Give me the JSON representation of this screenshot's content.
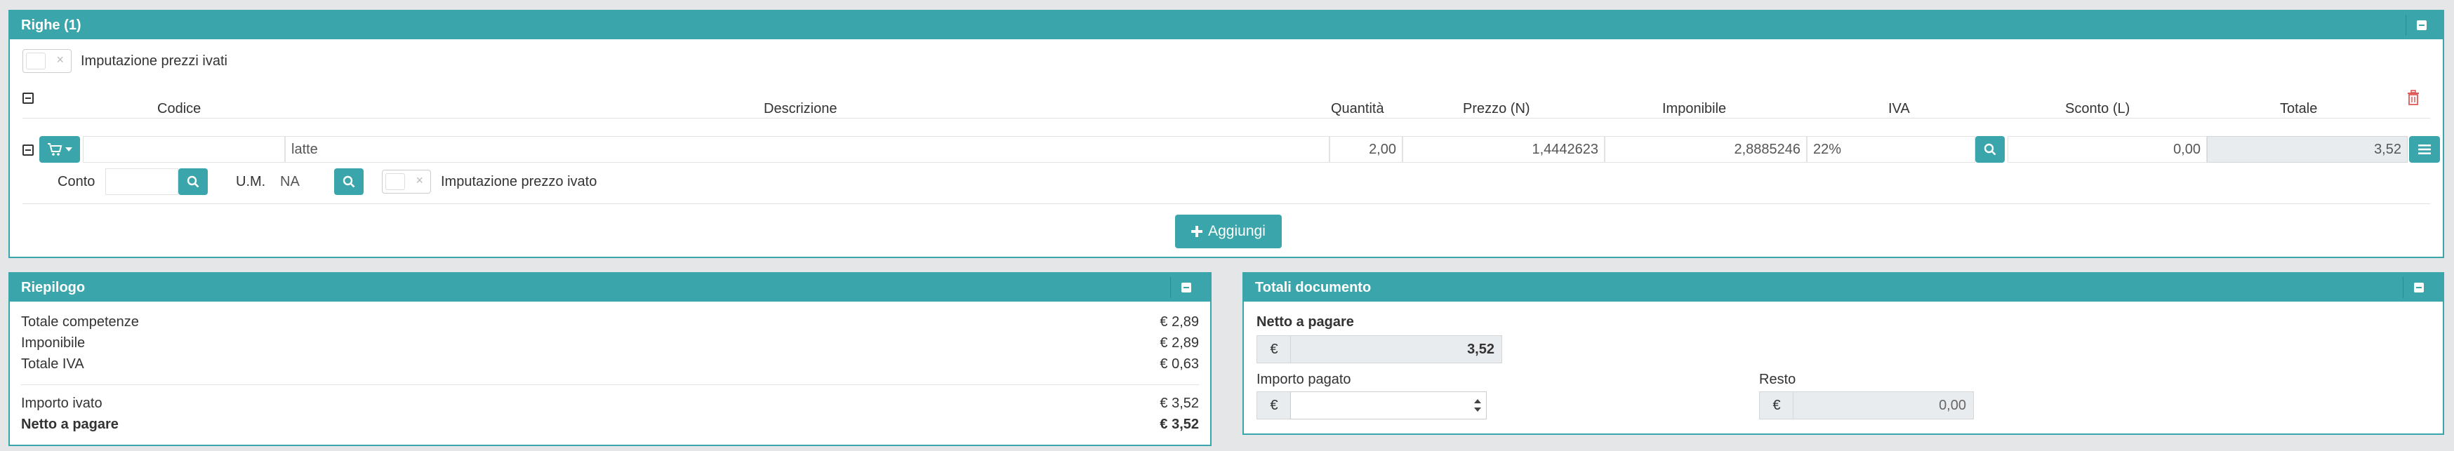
{
  "righe": {
    "title": "Righe (1)",
    "imputazione_label": "Imputazione prezzi ivati",
    "headers": {
      "codice": "Codice",
      "descrizione": "Descrizione",
      "quantita": "Quantità",
      "prezzo": "Prezzo (N)",
      "imponibile": "Imponibile",
      "iva": "IVA",
      "sconto": "Sconto (L)",
      "totale": "Totale"
    },
    "row": {
      "codice": "",
      "descrizione": "latte",
      "quantita": "2,00",
      "prezzo": "1,4442623",
      "imponibile": "2,8885246",
      "iva": "22%",
      "sconto": "0,00",
      "totale": "3,52",
      "conto_label": "Conto",
      "conto_value": "",
      "um_label": "U.M.",
      "um_value": "NA",
      "imputazione_prezzo_label": "Imputazione prezzo ivato"
    },
    "add_button": "Aggiungi"
  },
  "riepilogo": {
    "title": "Riepilogo",
    "rows": [
      {
        "label": "Totale competenze",
        "value": "€ 2,89"
      },
      {
        "label": "Imponibile",
        "value": "€ 2,89"
      },
      {
        "label": "Totale IVA",
        "value": "€ 0,63"
      }
    ],
    "importo_ivato_label": "Importo ivato",
    "importo_ivato_value": "€ 3,52",
    "netto_label": "Netto a pagare",
    "netto_value": "€ 3,52"
  },
  "totali": {
    "title": "Totali documento",
    "netto_label": "Netto a pagare",
    "netto_currency": "€",
    "netto_value": "3,52",
    "importo_pagato_label": "Importo pagato",
    "importo_pagato_currency": "€",
    "importo_pagato_value": "",
    "resto_label": "Resto",
    "resto_currency": "€",
    "resto_value": "0,00"
  },
  "colors": {
    "accent": "#3aa5aa",
    "danger": "#e05a5a",
    "readonly_bg": "#e9ecef"
  },
  "icons": {
    "collapse": "minus-square-icon",
    "cart": "cart-icon",
    "search": "search-icon",
    "trash": "trash-icon",
    "menu": "bars-icon",
    "plus": "plus-icon",
    "stepper": "spinner-arrows-icon"
  }
}
